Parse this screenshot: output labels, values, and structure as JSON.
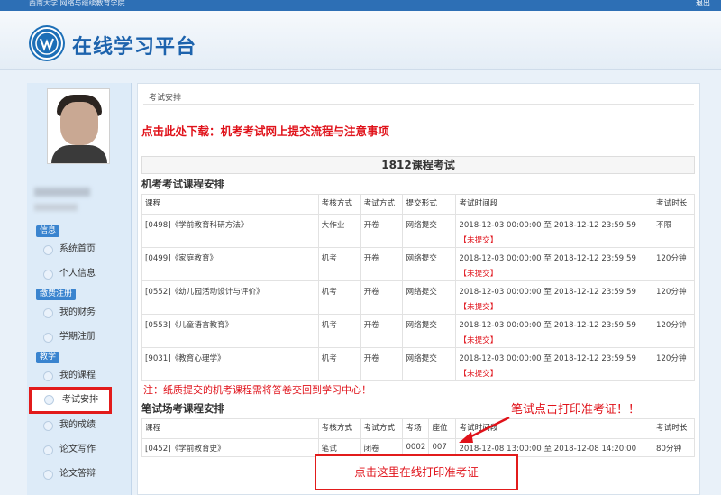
{
  "topbar": {
    "school": "西南大学 网络与继续教育学院",
    "logout": "退出"
  },
  "header": {
    "title": "在线学习平台"
  },
  "sidebar": {
    "sections": {
      "info": "信息",
      "payment": "缴费注册",
      "teaching": "教学"
    },
    "items": {
      "home": "系统首页",
      "profile": "个人信息",
      "finance": "我的财务",
      "term_register": "学期注册",
      "courses": "我的课程",
      "exams": "考试安排",
      "grades": "我的成绩",
      "thesis_writing": "论文写作",
      "thesis_defense": "论文答辩"
    }
  },
  "main": {
    "breadcrumb": "考试安排",
    "download_link": "点击此处下载：机考考试网上提交流程与注意事项",
    "term_title": "1812课程考试",
    "machine": {
      "title": "机考考试课程安排",
      "headers": [
        "课程",
        "考核方式",
        "考试方式",
        "提交形式",
        "考试时间段",
        "考试时长"
      ],
      "rows": [
        [
          "[0498]《学前教育科研方法》",
          "大作业",
          "开卷",
          "网络提交",
          "2018-12-03 00:00:00 至 2018-12-12 23:59:59",
          "【未提交】",
          "不限"
        ],
        [
          "[0499]《家庭教育》",
          "机考",
          "开卷",
          "网络提交",
          "2018-12-03 00:00:00 至 2018-12-12 23:59:59",
          "【未提交】",
          "120分钟"
        ],
        [
          "[0552]《幼儿园活动设计与评价》",
          "机考",
          "开卷",
          "网络提交",
          "2018-12-03 00:00:00 至 2018-12-12 23:59:59",
          "【未提交】",
          "120分钟"
        ],
        [
          "[0553]《儿童语言教育》",
          "机考",
          "开卷",
          "网络提交",
          "2018-12-03 00:00:00 至 2018-12-12 23:59:59",
          "【未提交】",
          "120分钟"
        ],
        [
          "[9031]《教育心理学》",
          "机考",
          "开卷",
          "网络提交",
          "2018-12-03 00:00:00 至 2018-12-12 23:59:59",
          "【未提交】",
          "120分钟"
        ]
      ]
    },
    "note": "注：纸质提交的机考课程需将答卷交回到学习中心！",
    "written": {
      "title": "笔试场考课程安排",
      "headers": [
        "课程",
        "考核方式",
        "考试方式",
        "考场",
        "座位",
        "考试时间段",
        "考试时长"
      ],
      "rows": [
        [
          "[0452]《学前教育史》",
          "笔试",
          "闭卷",
          "0002",
          "007",
          "2018-12-08 13:00:00 至 2018-12-08 14:20:00",
          "80分钟"
        ]
      ]
    },
    "annotation": "笔试点击打印准考证！！",
    "print_button": "点击这里在线打印准考证"
  }
}
